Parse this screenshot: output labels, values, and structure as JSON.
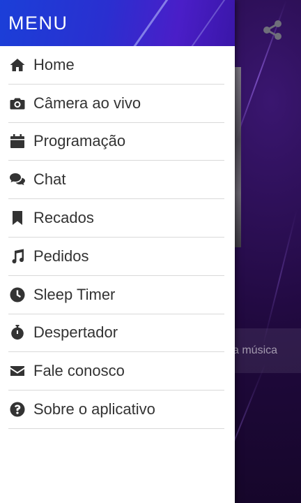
{
  "drawer": {
    "title": "MENU",
    "items": [
      {
        "label": "Home",
        "icon": "home-icon"
      },
      {
        "label": "Câmera ao vivo",
        "icon": "camera-icon"
      },
      {
        "label": "Programação",
        "icon": "calendar-icon"
      },
      {
        "label": "Chat",
        "icon": "comments-icon"
      },
      {
        "label": "Recados",
        "icon": "bookmark-icon"
      },
      {
        "label": "Pedidos",
        "icon": "music-icon"
      },
      {
        "label": "Sleep Timer",
        "icon": "clock-icon"
      },
      {
        "label": "Despertador",
        "icon": "stopwatch-icon"
      },
      {
        "label": "Fale conosco",
        "icon": "envelope-icon"
      },
      {
        "label": "Sobre o aplicativo",
        "icon": "question-circle-icon"
      }
    ]
  },
  "background": {
    "song_text": "a música",
    "share_icon": "share-icon"
  },
  "colors": {
    "header_start": "#1b3fd8",
    "header_end": "#4a1ec8",
    "drawer_bg": "#ffffff",
    "text": "#333333",
    "divider": "#d9d9d9"
  }
}
